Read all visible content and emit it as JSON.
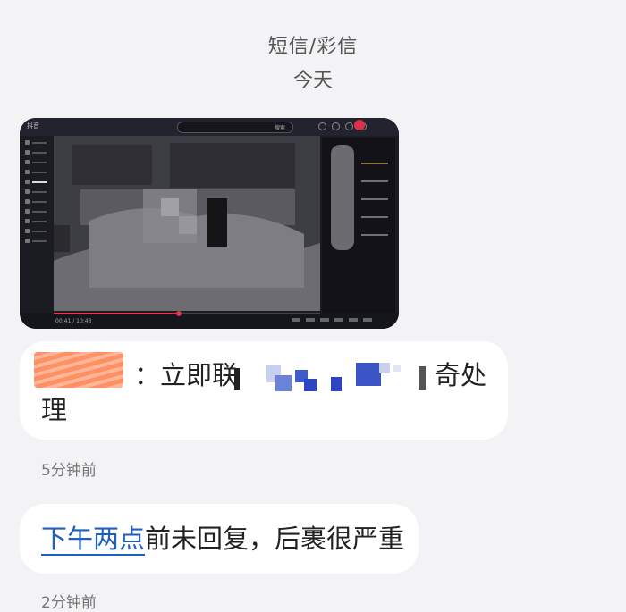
{
  "header": {
    "title": "短信/彩信",
    "date": "今天"
  },
  "mms": {
    "app_label": "抖音",
    "search_label": "搜索",
    "timecode": "00:41 / 10:43",
    "accent": "#e2344f",
    "progress_fraction": 0.47
  },
  "messages": [
    {
      "line1_prefix": "：立即联",
      "line1_suffix": "奇处",
      "line2": "理",
      "time": "5分钟前"
    },
    {
      "link": "下午两点",
      "rest": "前未回复，后裹很严重",
      "time": "2分钟前"
    }
  ]
}
